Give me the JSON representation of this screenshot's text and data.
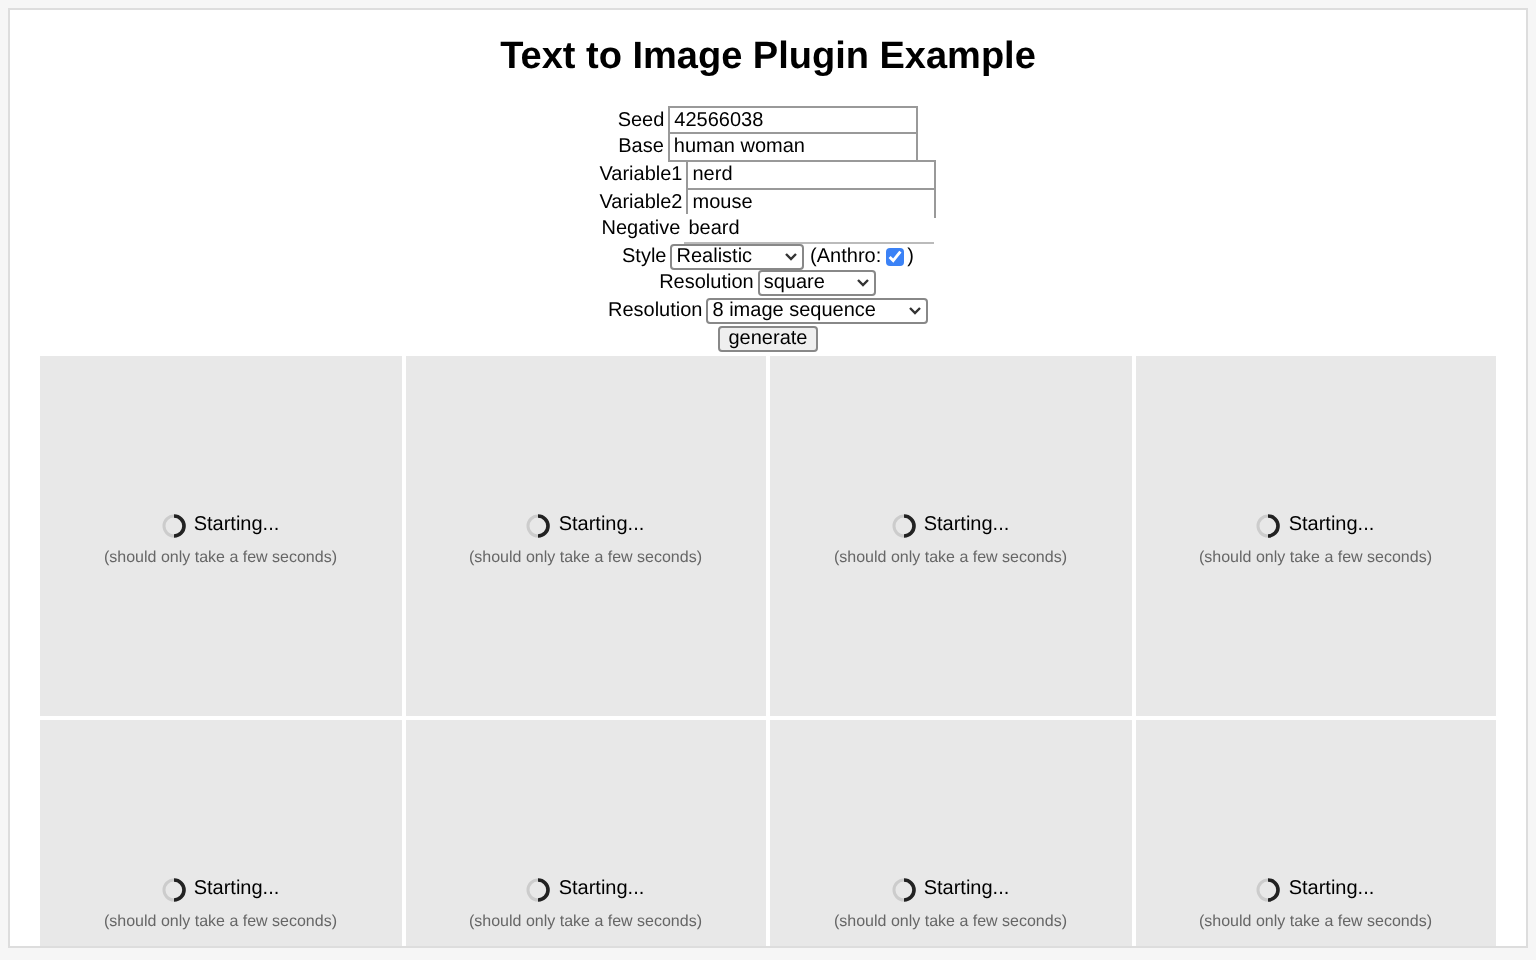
{
  "title": "Text to Image Plugin Example",
  "fields": [
    {
      "label": "Seed",
      "kind": "text",
      "value": "42566038"
    },
    {
      "label": "Base",
      "kind": "text",
      "value": "human woman"
    },
    {
      "label": "Variable1",
      "kind": "text",
      "value": "nerd"
    },
    {
      "label": "Variable2",
      "kind": "text",
      "value": "mouse"
    },
    {
      "label": "Negative",
      "kind": "plain",
      "value": "beard"
    },
    {
      "label": "Style",
      "kind": "select",
      "value": "Realistic",
      "extra": {
        "label": "(Anthro:",
        "close": ")",
        "checked": true
      }
    },
    {
      "label": "Resolution",
      "kind": "select",
      "value": "square"
    },
    {
      "label": "Resolution",
      "kind": "select",
      "value": "8 image sequence"
    }
  ],
  "button": "generate",
  "tiles": [
    {
      "status": "Starting...",
      "note": "(should only take a few seconds)"
    },
    {
      "status": "Starting...",
      "note": "(should only take a few seconds)"
    },
    {
      "status": "Starting...",
      "note": "(should only take a few seconds)"
    },
    {
      "status": "Starting...",
      "note": "(should only take a few seconds)"
    },
    {
      "status": "Starting...",
      "note": "(should only take a few seconds)"
    },
    {
      "status": "Starting...",
      "note": "(should only take a few seconds)"
    },
    {
      "status": "Starting...",
      "note": "(should only take a few seconds)"
    },
    {
      "status": "Starting...",
      "note": "(should only take a few seconds)"
    }
  ]
}
